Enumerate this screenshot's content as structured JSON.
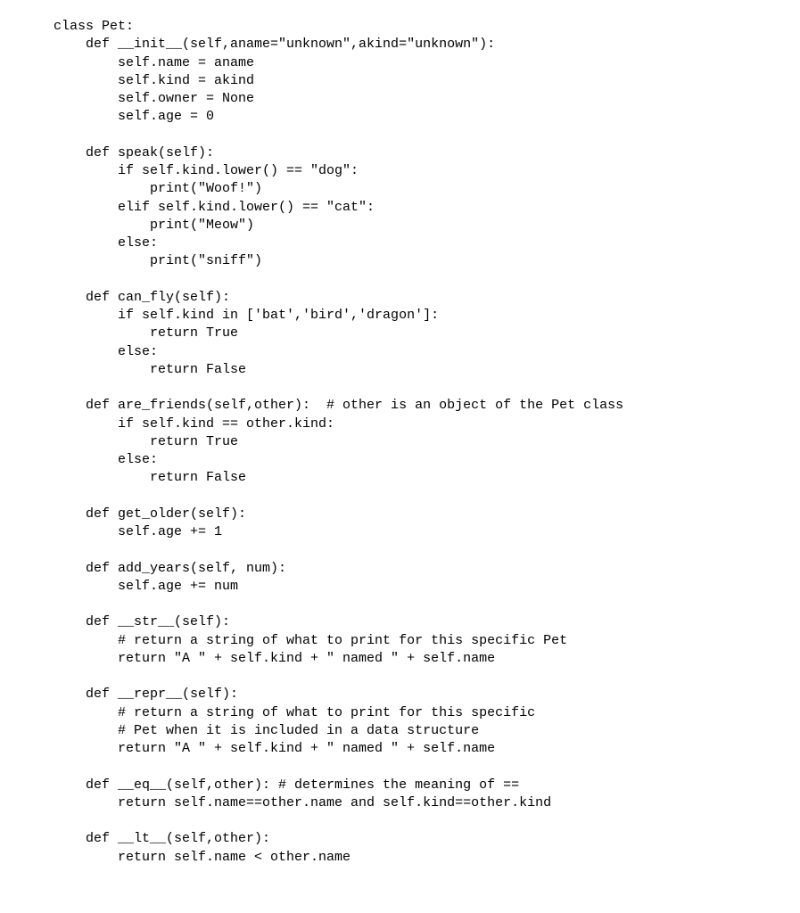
{
  "code": {
    "lines": [
      "class Pet:",
      "    def __init__(self,aname=\"unknown\",akind=\"unknown\"):",
      "        self.name = aname",
      "        self.kind = akind",
      "        self.owner = None",
      "        self.age = 0",
      "",
      "    def speak(self):",
      "        if self.kind.lower() == \"dog\":",
      "            print(\"Woof!\")",
      "        elif self.kind.lower() == \"cat\":",
      "            print(\"Meow\")",
      "        else:",
      "            print(\"sniff\")",
      "",
      "    def can_fly(self):",
      "        if self.kind in ['bat','bird','dragon']:",
      "            return True",
      "        else:",
      "            return False",
      "",
      "    def are_friends(self,other):  # other is an object of the Pet class",
      "        if self.kind == other.kind:",
      "            return True",
      "        else:",
      "            return False",
      "",
      "    def get_older(self):",
      "        self.age += 1",
      "",
      "    def add_years(self, num):",
      "        self.age += num",
      "",
      "    def __str__(self):",
      "        # return a string of what to print for this specific Pet",
      "        return \"A \" + self.kind + \" named \" + self.name",
      "",
      "    def __repr__(self):",
      "        # return a string of what to print for this specific",
      "        # Pet when it is included in a data structure",
      "        return \"A \" + self.kind + \" named \" + self.name",
      "",
      "    def __eq__(self,other): # determines the meaning of ==",
      "        return self.name==other.name and self.kind==other.kind",
      "",
      "    def __lt__(self,other):",
      "        return self.name < other.name"
    ]
  }
}
